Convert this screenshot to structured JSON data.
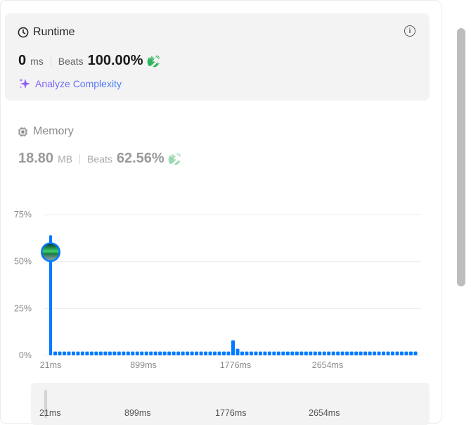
{
  "runtime": {
    "title": "Runtime",
    "value": "0",
    "unit": "ms",
    "beats_label": "Beats",
    "beats_value": "100.00%",
    "analyze_label": "Analyze Complexity"
  },
  "memory": {
    "title": "Memory",
    "value": "18.80",
    "unit": "MB",
    "beats_label": "Beats",
    "beats_value": "62.56%"
  },
  "colors": {
    "accent_bar": "#007aff",
    "hand_green": "#2db55d",
    "hand_green_faded": "#9ad9b0"
  },
  "chart_data": {
    "type": "bar",
    "ylim": [
      0,
      75
    ],
    "y_ticks": [
      "75%",
      "50%",
      "25%",
      "0%"
    ],
    "y_tick_values": [
      75,
      50,
      25,
      0
    ],
    "x_tick_labels": [
      "21ms",
      "899ms",
      "1776ms",
      "2654ms"
    ],
    "values": [
      64,
      2,
      2,
      2,
      2,
      2,
      2,
      2,
      2,
      2,
      2,
      2,
      2,
      2,
      2,
      2,
      2,
      2,
      2,
      2,
      2,
      2,
      2,
      2,
      2,
      2,
      2,
      2,
      2,
      2,
      2,
      2,
      2,
      2,
      2,
      2,
      2,
      2,
      2,
      2,
      8,
      3.5,
      2,
      2,
      2,
      2,
      2,
      2,
      2,
      2,
      2,
      2,
      2,
      2,
      2,
      2,
      2,
      2,
      2,
      2,
      2,
      2,
      2,
      2,
      2,
      2,
      2,
      2,
      2,
      2,
      2,
      2,
      2,
      2,
      2,
      2,
      2,
      2,
      2,
      2,
      2
    ],
    "marker_value": 55
  },
  "mini_chart": {
    "x_tick_labels": [
      "21ms",
      "899ms",
      "1776ms",
      "2654ms"
    ]
  }
}
